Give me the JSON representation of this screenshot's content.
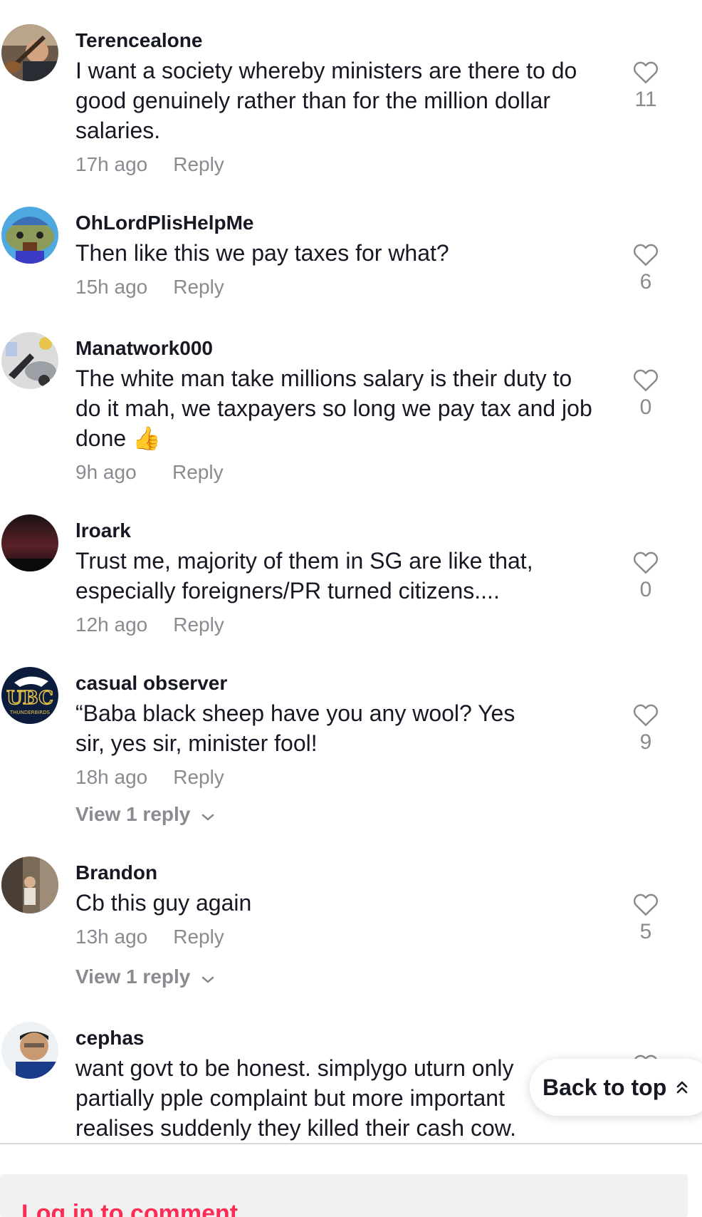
{
  "comments": [
    {
      "username": "Terencealone",
      "text": "I want a society whereby ministers are there to do good genuinely rather than for the million dollar salaries.",
      "time": "17h ago",
      "reply_label": "Reply",
      "likes": "11",
      "avatar": "person-with-instrument-avatar"
    },
    {
      "username": "OhLordPlisHelpMe",
      "text": "Then like this we pay taxes for what?",
      "time": "15h ago",
      "reply_label": "Reply",
      "likes": "6",
      "avatar": "cartoon-frog-avatar"
    },
    {
      "username": "Manatwork000",
      "text": "The white man take millions salary is their duty to do it mah, we taxpayers so long we pay tax and job done 👍",
      "time": "9h ago",
      "reply_label": "Reply",
      "likes": "0",
      "avatar": "scooter-photo-avatar"
    },
    {
      "username": "lroark",
      "text": "Trust me, majority of them in SG are like that, especially foreigners/PR turned citizens....",
      "time": "12h ago",
      "reply_label": "Reply",
      "likes": "0",
      "avatar": "dark-sky-avatar"
    },
    {
      "username": "casual observer",
      "text": "“Baba black sheep have you any wool? Yes sir, yes sir, minister fool!",
      "time": "18h ago",
      "reply_label": "Reply",
      "likes": "9",
      "view_replies": "View 1 reply",
      "avatar": "ubc-thunderbirds-logo-avatar",
      "avatar_text": "UBC",
      "avatar_subtext": "THUNDERBIRDS"
    },
    {
      "username": "Brandon",
      "text": "Cb this guy again",
      "time": "13h ago",
      "reply_label": "Reply",
      "likes": "5",
      "view_replies": "View 1 reply",
      "avatar": "street-photo-avatar"
    },
    {
      "username": "cephas",
      "text": "want govt to be honest. simplygo uturn only partially pple complaint but more important realises suddenly they killed their cash cow.",
      "avatar": "selfie-photo-avatar"
    }
  ],
  "back_to_top": "Back to top",
  "login_prompt": "Log in to comment",
  "colors": {
    "primary_text": "#161823",
    "secondary_text": "#8a8b91",
    "accent": "#fe2c55",
    "divider": "#d9d9dc"
  }
}
